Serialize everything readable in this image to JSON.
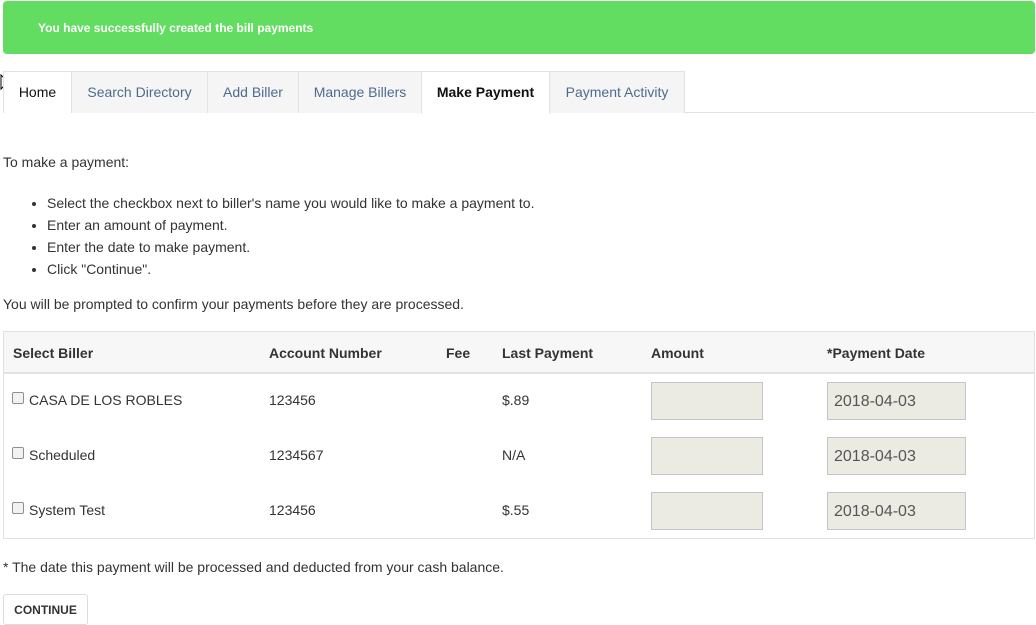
{
  "alert": {
    "message": "You have successfully created the bill payments",
    "color": "#62dd62"
  },
  "tabs": [
    {
      "label": "Home"
    },
    {
      "label": "Search Directory"
    },
    {
      "label": "Add Biller"
    },
    {
      "label": "Manage Billers"
    },
    {
      "label": "Make Payment"
    },
    {
      "label": "Payment Activity"
    }
  ],
  "active_tab": "Make Payment",
  "instructions": {
    "intro": "To make a payment:",
    "steps": [
      "Select the checkbox next to biller's name you would like to make a payment to.",
      "Enter an amount of payment.",
      "Enter the date to make payment.",
      "Click \"Continue\"."
    ],
    "prompt": "You will be prompted to confirm your payments before they are processed."
  },
  "table": {
    "headers": {
      "select_biller": "Select Biller",
      "account_number": "Account Number",
      "fee": "Fee",
      "last_payment": "Last Payment",
      "amount": "Amount",
      "payment_date": "*Payment Date"
    },
    "rows": [
      {
        "biller": "CASA DE LOS ROBLES",
        "account": "123456",
        "fee": "",
        "last_payment": "$.89",
        "amount": "",
        "date": "2018-04-03"
      },
      {
        "biller": "Scheduled",
        "account": "1234567",
        "fee": "",
        "last_payment": "N/A",
        "amount": "",
        "date": "2018-04-03"
      },
      {
        "biller": "System Test",
        "account": "123456",
        "fee": "",
        "last_payment": "$.55",
        "amount": "",
        "date": "2018-04-03"
      }
    ]
  },
  "footnote": "* The date this payment will be processed and deducted from your cash balance.",
  "continue_label": "CONTINUE"
}
